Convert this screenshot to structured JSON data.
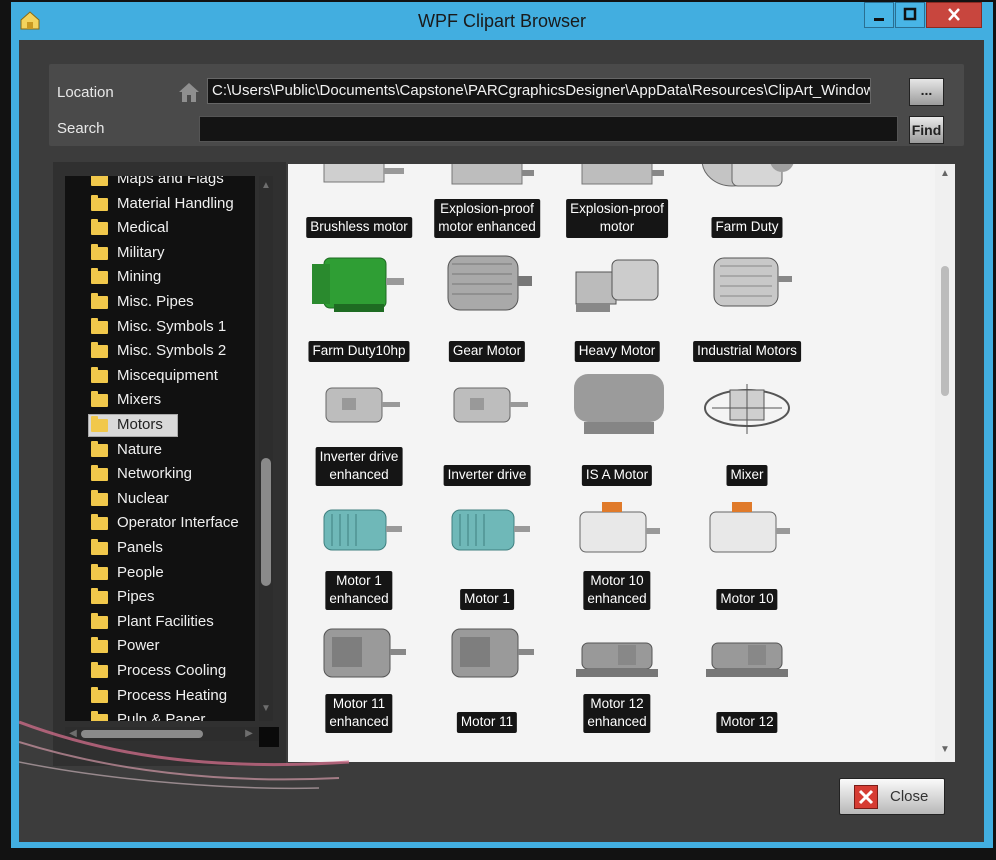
{
  "window": {
    "title": "WPF Clipart Browser"
  },
  "location": {
    "label": "Location",
    "path": "C:\\Users\\Public\\Documents\\Capstone\\PARCgraphicsDesigner\\AppData\\Resources\\ClipArt_Windows",
    "browse_label": "..."
  },
  "search": {
    "label": "Search",
    "value": "",
    "find_label": "Find"
  },
  "tree": {
    "items": [
      {
        "label": "Maps and Flags"
      },
      {
        "label": "Material Handling"
      },
      {
        "label": "Medical"
      },
      {
        "label": "Military"
      },
      {
        "label": "Mining"
      },
      {
        "label": "Misc. Pipes"
      },
      {
        "label": "Misc. Symbols 1"
      },
      {
        "label": "Misc. Symbols 2"
      },
      {
        "label": "Miscequipment"
      },
      {
        "label": "Mixers"
      },
      {
        "label": "Motors",
        "selected": true
      },
      {
        "label": "Nature"
      },
      {
        "label": "Networking"
      },
      {
        "label": "Nuclear"
      },
      {
        "label": "Operator Interface"
      },
      {
        "label": "Panels"
      },
      {
        "label": "People"
      },
      {
        "label": "Pipes"
      },
      {
        "label": "Plant Facilities"
      },
      {
        "label": "Power"
      },
      {
        "label": "Process Cooling"
      },
      {
        "label": "Process Heating"
      },
      {
        "label": "Pulp & Paper"
      }
    ]
  },
  "clips": [
    {
      "label": "Brushless motor",
      "icon": "brushless-motor-icon"
    },
    {
      "label": "Explosion-proof\nmotor enhanced",
      "icon": "explosion-proof-motor-icon"
    },
    {
      "label": "Explosion-proof\nmotor",
      "icon": "explosion-proof-motor-icon"
    },
    {
      "label": "Farm Duty",
      "icon": "farm-duty-motor-icon"
    },
    {
      "label": "Farm Duty10hp",
      "icon": "green-motor-icon"
    },
    {
      "label": "Gear Motor",
      "icon": "gear-motor-icon"
    },
    {
      "label": "Heavy Motor",
      "icon": "heavy-motor-icon"
    },
    {
      "label": "Industrial Motors",
      "icon": "industrial-motor-icon"
    },
    {
      "label": "Inverter drive\nenhanced",
      "icon": "inverter-drive-icon"
    },
    {
      "label": "Inverter drive",
      "icon": "inverter-drive-icon"
    },
    {
      "label": "IS A Motor",
      "icon": "isa-motor-icon"
    },
    {
      "label": "Mixer",
      "icon": "mixer-icon"
    },
    {
      "label": "Motor 1\nenhanced",
      "icon": "teal-motor-icon"
    },
    {
      "label": "Motor 1",
      "icon": "teal-motor-icon"
    },
    {
      "label": "Motor 10\nenhanced",
      "icon": "motor-orange-box-icon"
    },
    {
      "label": "Motor 10",
      "icon": "motor-orange-box-icon"
    },
    {
      "label": "Motor 11\nenhanced",
      "icon": "gray-motor-icon"
    },
    {
      "label": "Motor 11",
      "icon": "gray-motor-icon"
    },
    {
      "label": "Motor 12\nenhanced",
      "icon": "motor-base-icon"
    },
    {
      "label": "Motor 12",
      "icon": "motor-base-icon"
    }
  ],
  "footer": {
    "close_label": "Close"
  },
  "colors": {
    "frame": "#42aee0",
    "client": "#3c3c3c",
    "close_red": "#d63c33",
    "folder": "#f1c84b"
  }
}
